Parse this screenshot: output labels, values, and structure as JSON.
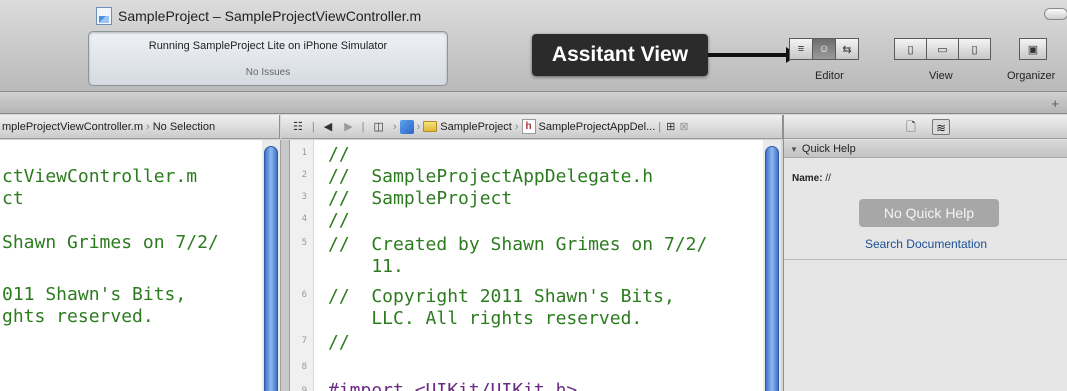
{
  "window": {
    "title": "SampleProject – SampleProjectViewController.m"
  },
  "activity": {
    "status": "Running SampleProject Lite on iPhone Simulator",
    "issues": "No Issues"
  },
  "callout": {
    "label": "Assitant View"
  },
  "toolbar": {
    "editor_label": "Editor",
    "view_label": "View",
    "organizer_label": "Organizer",
    "editor_selected": "assistant"
  },
  "jump_left": {
    "file": "mpleProjectViewController.m",
    "selection": "No Selection"
  },
  "jump_right": {
    "folder": "SampleProject",
    "file": "SampleProjectAppDel..."
  },
  "left_editor": {
    "lines": [
      "ctViewController.m",
      "ct",
      "",
      "Shawn Grimes on 7/2/",
      "",
      "011 Shawn's Bits,",
      "ghts reserved."
    ]
  },
  "right_editor": {
    "line_numbers": [
      "1",
      "2",
      "3",
      "4",
      "5",
      "6",
      "7",
      "8",
      "9"
    ],
    "lines": [
      "//",
      "//  SampleProjectAppDelegate.h",
      "//  SampleProject",
      "//",
      "//  Created by Shawn Grimes on 7/2/",
      "    11.",
      "//  Copyright 2011 Shawn's Bits,",
      "    LLC. All rights reserved.",
      "//",
      "",
      "#import <UIKit/UIKit.h>"
    ]
  },
  "quick_help": {
    "header": "Quick Help",
    "name_label": "Name:",
    "name_value": "//",
    "no_help": "No Quick Help",
    "search_link": "Search Documentation"
  }
}
